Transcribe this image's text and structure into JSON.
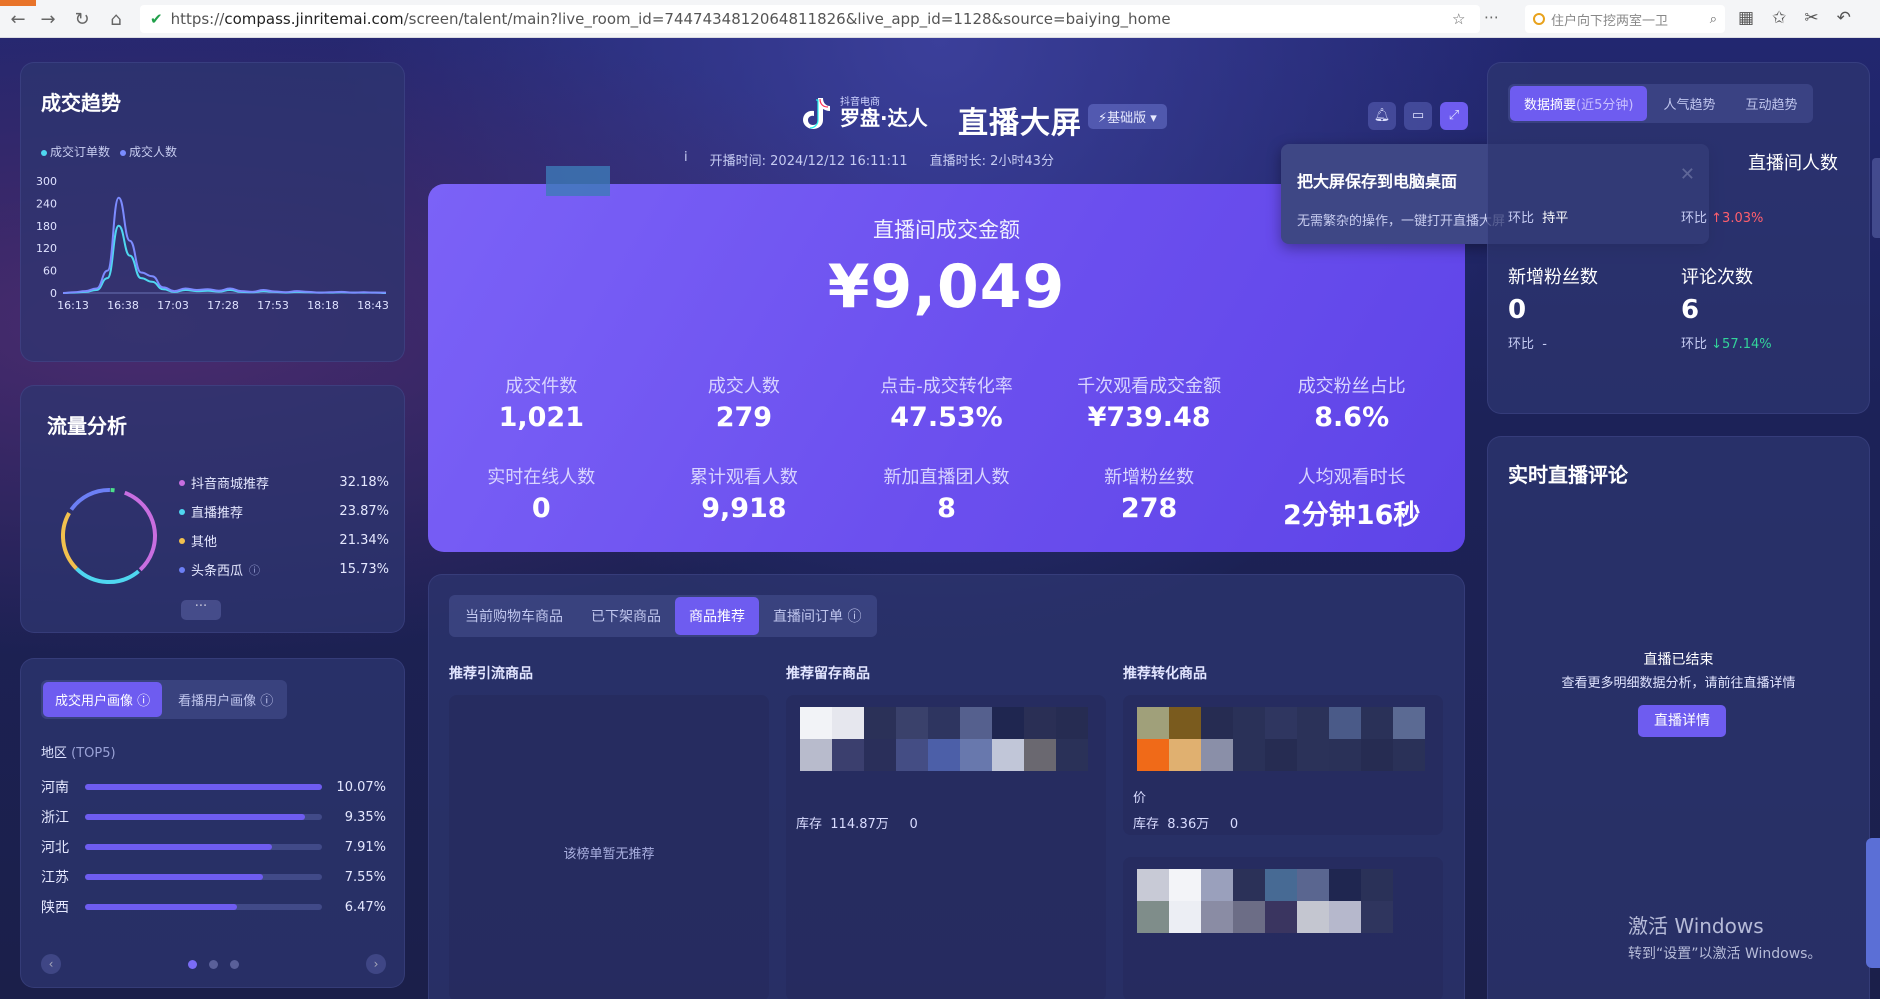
{
  "browser": {
    "url_scheme": "https://",
    "url_host": "compass.jinritemai.com",
    "url_path": "/screen/talent/main?live_room_id=7447434812064811826&live_app_id=1128&source=baiying_home",
    "search_text": "住户向下挖两室一卫"
  },
  "header": {
    "logo_small": "抖音电商",
    "logo_big": "罗盘·达人",
    "title": "直播大屏",
    "version": "⚡基础版 ▾",
    "start_label": "开播时间:",
    "start_value": "2024/12/12 16:11:11",
    "duration_label": "直播时长:",
    "duration_value": "2小时43分"
  },
  "trend": {
    "title": "成交趋势",
    "legend": [
      "成交订单数",
      "成交人数"
    ]
  },
  "chart_data": {
    "type": "line",
    "title": "成交趋势",
    "x": [
      "16:13",
      "16:38",
      "17:03",
      "17:28",
      "17:53",
      "18:18",
      "18:43"
    ],
    "yticks": [
      0,
      60,
      120,
      180,
      240,
      300
    ],
    "ylim": [
      0,
      300
    ],
    "series": [
      {
        "name": "成交订单数",
        "values": [
          0,
          2,
          5,
          12,
          60,
          255,
          140,
          55,
          45,
          15,
          5,
          12,
          8,
          10,
          6,
          12,
          5,
          3,
          8,
          4,
          2,
          5,
          3,
          1,
          2,
          3,
          1,
          2,
          1,
          1
        ]
      },
      {
        "name": "成交人数",
        "values": [
          0,
          1,
          3,
          8,
          40,
          180,
          100,
          40,
          30,
          10,
          3,
          8,
          5,
          6,
          4,
          8,
          3,
          2,
          5,
          3,
          1,
          3,
          2,
          1,
          1,
          2,
          1,
          1,
          1,
          0
        ]
      }
    ]
  },
  "traffic": {
    "title": "流量分析",
    "items": [
      {
        "label": "抖音商城推荐",
        "value": "32.18%",
        "color": "#c86ee0"
      },
      {
        "label": "直播推荐",
        "value": "23.87%",
        "color": "#4fd7f0"
      },
      {
        "label": "其他",
        "value": "21.34%",
        "color": "#f2c14e"
      },
      {
        "label": "头条西瓜",
        "value": "15.73%",
        "color": "#6c7ff5"
      }
    ],
    "more": "···"
  },
  "portrait": {
    "tab_active": "成交用户画像",
    "tab_other": "看播用户画像",
    "region_title": "地区",
    "region_sub": "(TOP5)",
    "regions": [
      {
        "name": "河南",
        "value": "10.07%",
        "ratio": 1.0
      },
      {
        "name": "浙江",
        "value": "9.35%",
        "ratio": 0.93
      },
      {
        "name": "河北",
        "value": "7.91%",
        "ratio": 0.79
      },
      {
        "name": "江苏",
        "value": "7.55%",
        "ratio": 0.75
      },
      {
        "name": "陕西",
        "value": "6.47%",
        "ratio": 0.64
      }
    ]
  },
  "hero": {
    "caption": "直播间成交金额",
    "amount": "¥9,049",
    "metrics": [
      {
        "label": "成交件数",
        "value": "1,021"
      },
      {
        "label": "成交人数",
        "value": "279"
      },
      {
        "label": "点击-成交转化率",
        "value": "47.53%"
      },
      {
        "label": "千次观看成交金额",
        "value": "¥739.48"
      },
      {
        "label": "成交粉丝占比",
        "value": "8.6%"
      },
      {
        "label": "实时在线人数",
        "value": "0"
      },
      {
        "label": "累计观看人数",
        "value": "9,918"
      },
      {
        "label": "新加直播团人数",
        "value": "8"
      },
      {
        "label": "新增粉丝数",
        "value": "278"
      },
      {
        "label": "人均观看时长",
        "value": "2分钟16秒"
      }
    ]
  },
  "popup": {
    "title": "把大屏保存到电脑桌面",
    "desc": "无需繁杂的操作，一键打开直播大屏",
    "close": "✕"
  },
  "products": {
    "tabs": [
      "当前购物车商品",
      "已下架商品",
      "商品推荐",
      "直播间订单 ⓘ"
    ],
    "active_tab": "商品推荐",
    "col1_title": "推荐引流商品",
    "col2_title": "推荐留存商品",
    "col3_title": "推荐转化商品",
    "empty": "该榜单暂无推荐",
    "col2_stock_label": "库存",
    "col2_stock_value": "114.87万",
    "col2_stock_extra": "0",
    "col3_price_label": "价",
    "col3_stock_label": "库存",
    "col3_stock_value": "8.36万",
    "col3_stock_extra": "0"
  },
  "summary": {
    "tab_active": "数据摘要",
    "tab_active_hint": "(近5分钟)",
    "tabs": [
      "人气趋势",
      "互动趋势"
    ],
    "top_right_label": "直播间人数",
    "blocks": [
      {
        "label": "",
        "value": "",
        "change_label": "环比",
        "change": "持平"
      },
      {
        "label": "",
        "value": "",
        "change_label": "环比",
        "change": "↑3.03%"
      },
      {
        "label": "新增粉丝数",
        "value": "0",
        "change_label": "环比",
        "change": "-"
      },
      {
        "label": "评论次数",
        "value": "6",
        "change_label": "环比",
        "change": "↓57.14%"
      }
    ]
  },
  "comments": {
    "title": "实时直播评论",
    "ended": "直播已结束",
    "ended_sub": "查看更多明细数据分析，请前往直播详情",
    "button": "直播详情"
  },
  "watermark": {
    "line1": "激活 Windows",
    "line2": "转到“设置”以激活 Windows。"
  }
}
